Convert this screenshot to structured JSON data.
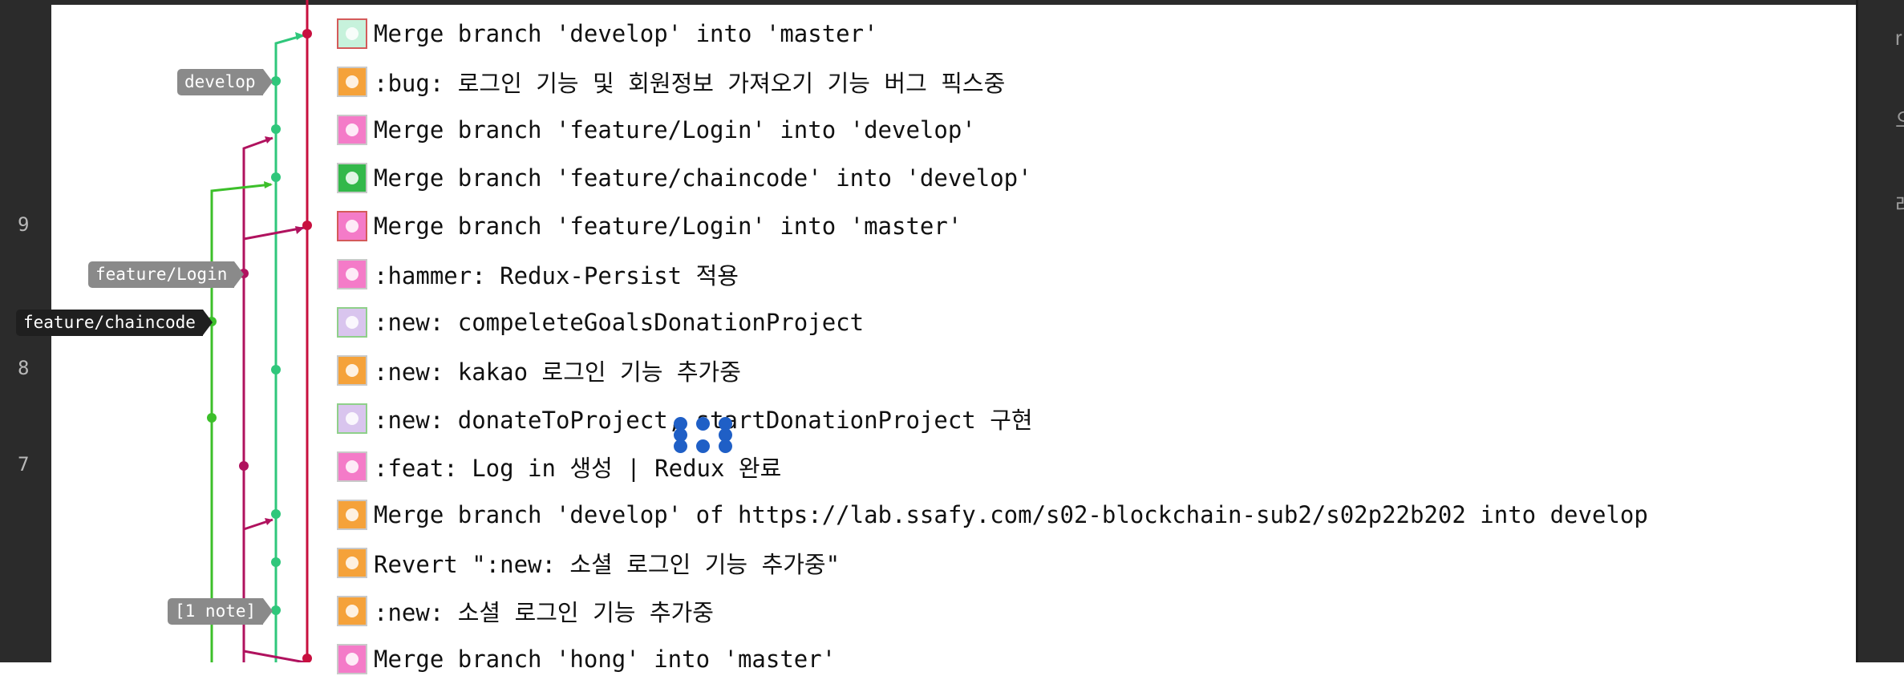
{
  "gutter": {
    "line_numbers": [
      "9",
      "8",
      "7"
    ]
  },
  "right_strip": {
    "glyphs": [
      "r",
      "으",
      "레"
    ]
  },
  "refs": {
    "develop": "develop",
    "feature_login": "feature/Login",
    "feature_chaincode": "feature/chaincode",
    "note": "[1 note]"
  },
  "colors": {
    "master_branch": "#c8103f",
    "develop_branch": "#2fc77b",
    "login_branch": "#b0125e",
    "chaincode_branch": "#3cbf2a",
    "selection_handles": "#1f5fc6"
  },
  "commits": [
    {
      "message": "Merge branch 'develop' into 'master'",
      "avatar": "mint-pattern"
    },
    {
      "message": ":bug: 로그인 기능 및 회원정보 가져오기 기능 버그 픽스중",
      "avatar": "orange-pattern"
    },
    {
      "message": "Merge branch 'feature/Login' into 'develop'",
      "avatar": "pink-pattern"
    },
    {
      "message": "Merge branch 'feature/chaincode' into 'develop'",
      "avatar": "green-pattern"
    },
    {
      "message": "Merge branch 'feature/Login' into 'master'",
      "avatar": "pink-pattern"
    },
    {
      "message": ":hammer: Redux-Persist 적용",
      "avatar": "pink-pattern"
    },
    {
      "message": ":new: compeleteGoalsDonationProject",
      "avatar": "lavender-pattern"
    },
    {
      "message": ":new: kakao 로그인 기능 추가중",
      "avatar": "orange-pattern"
    },
    {
      "message": ":new: donateToProject, startDonationProject 구현",
      "avatar": "lavender-pattern"
    },
    {
      "message": ":feat: Log in 생성 | Redux 완료",
      "avatar": "pink-pattern"
    },
    {
      "message": "Merge branch 'develop' of https://lab.ssafy.com/s02-blockchain-sub2/s02p22b202 into develop",
      "avatar": "orange-pattern"
    },
    {
      "message": "Revert \":new: 소셜 로그인 기능 추가중\"",
      "avatar": "orange-pattern"
    },
    {
      "message": ":new: 소셜 로그인 기능 추가중",
      "avatar": "orange-pattern"
    },
    {
      "message": "Merge branch 'hong' into 'master'",
      "avatar": "pink-pattern"
    }
  ]
}
